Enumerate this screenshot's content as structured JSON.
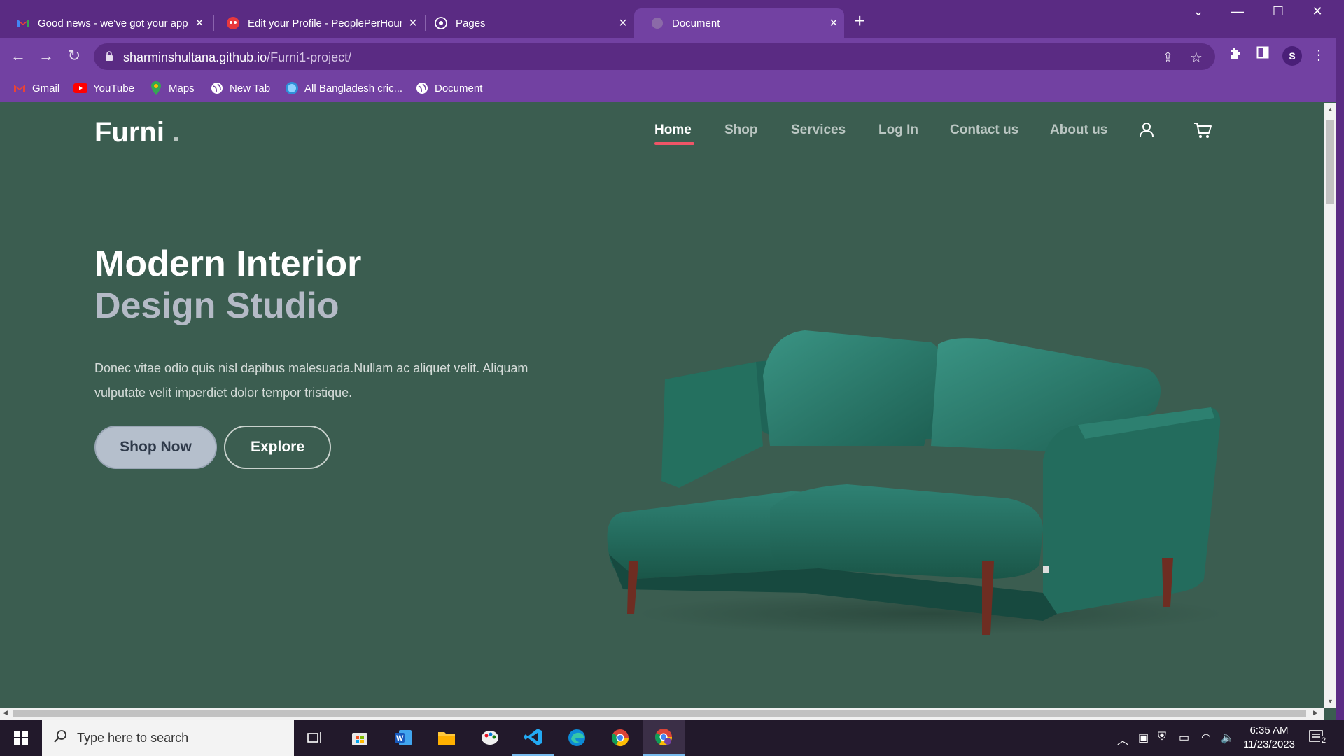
{
  "browser": {
    "tabs": [
      {
        "title": "Good news - we've got your app",
        "icon": "gmail-icon",
        "active": false
      },
      {
        "title": "Edit your Profile - PeoplePerHour",
        "icon": "peopleperhour-icon",
        "active": false
      },
      {
        "title": "Pages",
        "icon": "github-icon",
        "active": false
      },
      {
        "title": "Document",
        "icon": "globe-icon",
        "active": true
      }
    ],
    "url_host": "sharminshultana.github.io",
    "url_path": "/Furni1-project/",
    "profile_initial": "S",
    "accent_color": "#7241a2",
    "bookmarks": [
      {
        "label": "Gmail",
        "icon": "gmail-icon"
      },
      {
        "label": "YouTube",
        "icon": "youtube-icon"
      },
      {
        "label": "Maps",
        "icon": "maps-icon"
      },
      {
        "label": "New Tab",
        "icon": "globe-icon"
      },
      {
        "label": "All Bangladesh cric...",
        "icon": "cricket-icon"
      },
      {
        "label": "Document",
        "icon": "globe-icon"
      }
    ]
  },
  "site": {
    "logo": "Furni",
    "logo_dot": ".",
    "background_color": "#3b5d50",
    "nav": [
      {
        "label": "Home",
        "active": true
      },
      {
        "label": "Shop",
        "active": false
      },
      {
        "label": "Services",
        "active": false
      },
      {
        "label": "Log In",
        "active": false
      },
      {
        "label": "Contact us",
        "active": false
      },
      {
        "label": "About us",
        "active": false
      }
    ],
    "hero": {
      "title_line1": "Modern Interior",
      "title_line2": "Design Studio",
      "text": "Donec vitae odio quis nisl dapibus malesuada.Nullam ac aliquet velit. Aliquam vulputate velit imperdiet dolor tempor tristique.",
      "primary_button": "Shop Now",
      "secondary_button": "Explore"
    }
  },
  "taskbar": {
    "search_placeholder": "Type here to search",
    "time": "6:35 AM",
    "date": "11/23/2023",
    "notification_count": "2",
    "apps": [
      "task-view-icon",
      "store-icon",
      "word-icon",
      "file-explorer-icon",
      "paint-icon",
      "vscode-icon",
      "edge-icon",
      "chrome-icon",
      "chrome-profile-icon"
    ]
  }
}
